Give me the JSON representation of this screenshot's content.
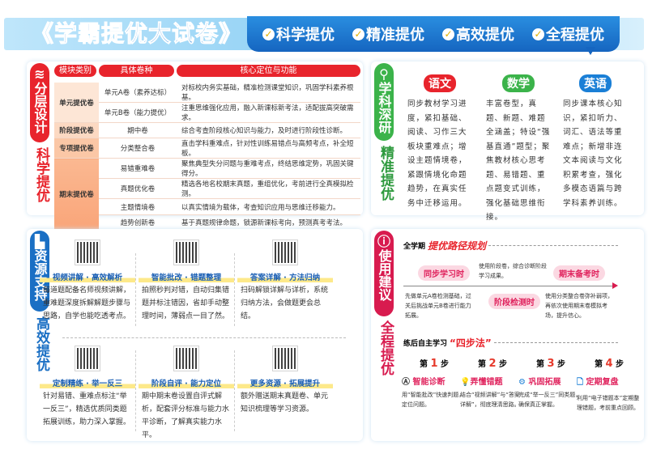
{
  "header": {
    "title": "《学霸提优大试卷》",
    "slogans": [
      "科学提优",
      "精准提优",
      "高效提优",
      "全程提优"
    ]
  },
  "layered": {
    "side_label": "分层设计",
    "side_sub": "科学提优",
    "headers": [
      "模块类别",
      "具体卷种",
      "核心定位与功能"
    ],
    "categories": [
      "单元提优卷",
      "阶段提优卷",
      "专项提优卷",
      "期末提优卷"
    ],
    "rows": [
      {
        "type": "单元A卷（素养达标）",
        "desc": "对标校内务实基础，精准检测课堂知识，巩固学科素养根基。"
      },
      {
        "type": "单元B卷（能力提优）",
        "desc": "注重思维强化应用，融入新课标新考法，适配拔高突破需求。"
      },
      {
        "type": "期中卷",
        "desc": "综合考查阶段核心知识与能力，及时进行阶段性诊断。"
      },
      {
        "type": "分类整合卷",
        "desc": "直击学科重难点，针对性训练易错点与高频考点，补全短板。"
      },
      {
        "type": "易错重难卷",
        "desc": "聚焦典型失分问题与重难考点，终结思维定势，巩固关键得分。"
      },
      {
        "type": "真题优化卷",
        "desc": "精选各地名校期末真题，重组优化，考前进行全真模拟检测。"
      },
      {
        "type": "主题情境卷",
        "desc": "以真实情境为载体，考查知识应用与思维迁移能力。"
      },
      {
        "type": "趋势创新卷",
        "desc": "基于真题规律命题，锁源新课标考向，预测真考考法。"
      }
    ]
  },
  "subjects": {
    "side_label": "学科深研",
    "side_sub": "精准提优",
    "items": [
      {
        "name": "语文",
        "color": "#e8242c",
        "desc": "同步教材学习进度，紧扣基础、阅读、习作三大板块重难点；增设主题情境卷，紧跟情境化命题趋势，在真实任务中迁移运用。"
      },
      {
        "name": "数学",
        "color": "#3bb34a",
        "desc": "丰富卷型，真题、新题、难题全涵盖；特设“强基直通”题型；聚焦教材核心思考题、易错题、重点题变式训练，强化基础思维衔接。"
      },
      {
        "name": "英语",
        "color": "#1a7fd6",
        "desc": "同步课本核心知识，紧扣听力、词汇、语法等重难点；新增非连文本阅读与文化积累考查，强化多模态语篇与跨学科素养训练。"
      }
    ]
  },
  "resources": {
    "side_label": "资源支持",
    "side_sub": "高效提优",
    "items": [
      {
        "title": "视频讲解 · 高效解析",
        "desc": "每道题配备名师视频讲解，重难题深度拆解解题步骤与思路，自学也能吃透考点。"
      },
      {
        "title": "智能批改 · 错题整理",
        "desc": "拍照秒判对错，自动归集错题并标注错因，省却手动整理时间，薄弱点一目了然。"
      },
      {
        "title": "答案详解 · 方法归纳",
        "desc": "扫码解锁详解与详析，系统归纳方法，会做题更会总结。"
      },
      {
        "title": "定制精练 · 举一反三",
        "desc": "针对易错、重难点标注“举一反三”，精选优质同类题拓展训练，助力深入掌握。"
      },
      {
        "title": "阶段自评 · 能力定位",
        "desc": "期中期末卷设置自评式解析，配套评分标准与能力水平诊断，了解真实能力水平。"
      },
      {
        "title": "更多资源 · 拓展提升",
        "desc": "额外赠送期末真题卷、单元知识梳理等学习资源。"
      }
    ]
  },
  "usage": {
    "side_label": "使用建议",
    "side_sub": "全程提优",
    "path_prefix": "全学期",
    "path_title": "提优路径规划",
    "stages": [
      {
        "label": "同步学习时",
        "desc": "先做单元A卷检测基础，过关后挑战单元B卷进行能力拓展。"
      },
      {
        "label": "阶段检测时",
        "desc": "使用阶段卷，综合诊断阶段学习成果。"
      },
      {
        "label": "期末备考时",
        "desc": "使用分类整合卷弥补弱项，再依次使用期末卷模拟考场，提升信心。"
      }
    ],
    "method_prefix": "练后自主学习",
    "method_title": "“四步法”",
    "steps": [
      {
        "num": "1",
        "title": "智能诊断",
        "desc": "用“智能批改”快速判题，定位问题。"
      },
      {
        "num": "2",
        "title": "弄懂错题",
        "desc": "结合“视频讲解”与“答案详解”，彻底理清思路。"
      },
      {
        "num": "3",
        "title": "巩固拓展",
        "desc": "完成“举一反三”同类题，确保真正掌握。"
      },
      {
        "num": "4",
        "title": "定期复盘",
        "desc": "利用“电子错题本”定期整理错题，考前重点回顾。"
      }
    ]
  }
}
